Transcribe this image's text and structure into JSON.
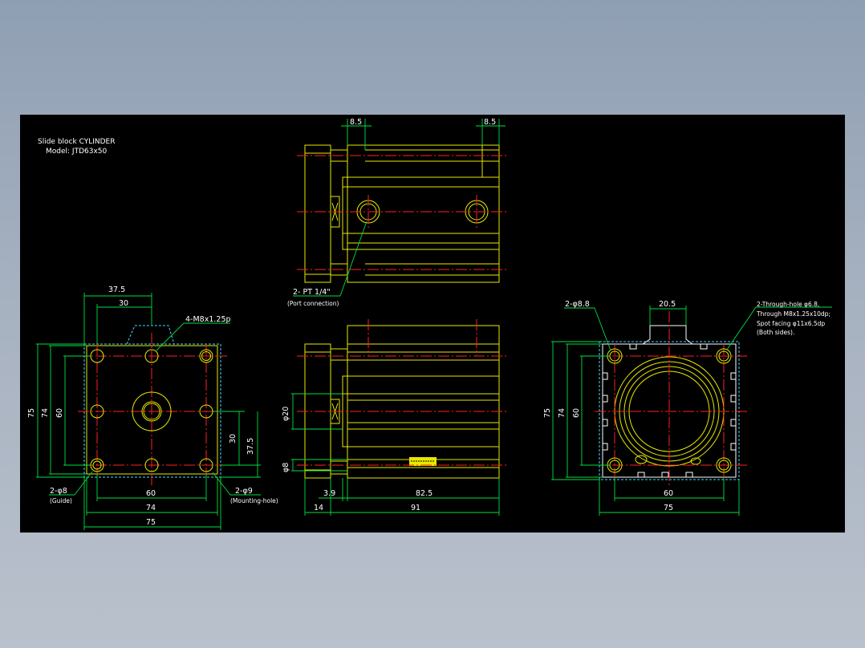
{
  "title": {
    "line1": "Slide block  CYLINDER",
    "line2": "Model:  JTD63x50"
  },
  "dims": {
    "d_37_5_top": "37.5",
    "d_30_top": "30",
    "d_75_left": "75",
    "d_74_left": "74",
    "d_60_left": "60",
    "d_30_right": "30",
    "d_37_5_right": "37.5",
    "d_60_bottom": "60",
    "d_74_bottom": "74",
    "d_75_bottom": "75",
    "d_8_5_a": "8.5",
    "d_8_5_b": "8.5",
    "d_phi20": "φ20",
    "d_phi8": "φ8",
    "d_3_9": "3.9",
    "d_82_5": "82.5",
    "d_14": "14",
    "d_91": "91",
    "d_20_5": "20.5",
    "d_75_rv": "75",
    "d_74_rv": "74",
    "d_60_rv": "60",
    "d_60_rv_bottom": "60",
    "d_75_rv_bottom": "75"
  },
  "callouts": {
    "m8": "4-M8x1.25p",
    "guide_holes": "2-φ8",
    "guide_note": "(Guide)",
    "mount_holes": "2-φ9",
    "mount_note": "(Mounting-hole)",
    "port": "2-  PT 1/4\"",
    "port_note": "(Port connection)",
    "phi8_8": "2-φ8.8",
    "through_1": "2-Through-hole φ6.8,",
    "through_2": "Through M8x1.25x10dp;",
    "through_3": "Spot facing φ11x6.5dp",
    "through_4": "(Both sides)."
  },
  "colors": {
    "outline": "#e8e800",
    "hidden": "#40d8ff",
    "center": "#ff2020",
    "dimension": "#00e040",
    "text": "#ffffff",
    "sheet": "#000000"
  }
}
